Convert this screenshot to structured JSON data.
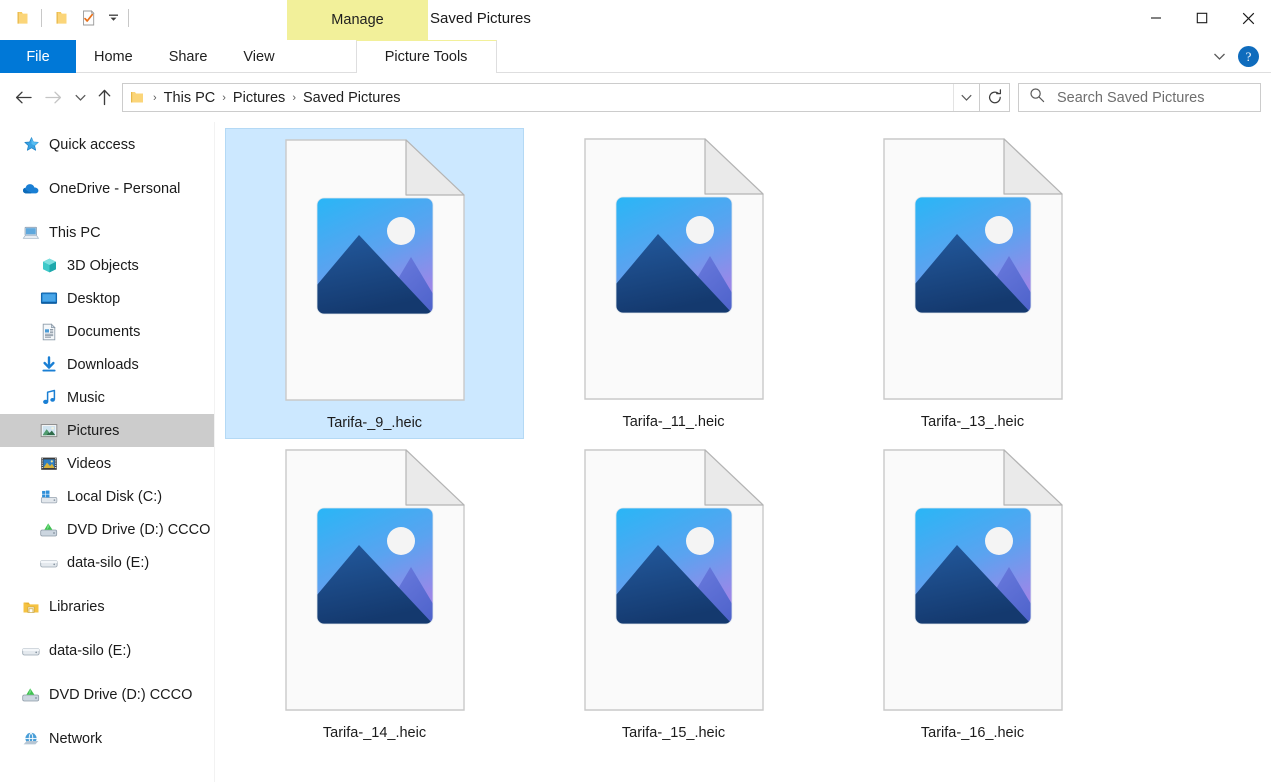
{
  "window": {
    "title": "Saved Pictures",
    "contextual_tab_header": "Manage",
    "controls": {
      "minimize": "minimize-button",
      "maximize": "maximize-button",
      "close": "close-button"
    }
  },
  "quick_access_toolbar": {
    "items": [
      {
        "name": "explorer-folder-icon",
        "icon": "folder"
      },
      {
        "name": "new-folder-icon",
        "icon": "folder"
      },
      {
        "name": "properties-icon",
        "icon": "properties"
      },
      {
        "name": "customize-dropdown",
        "icon": "chevron-down"
      }
    ]
  },
  "ribbon": {
    "tabs": [
      {
        "label": "File",
        "active": false,
        "style": "file"
      },
      {
        "label": "Home",
        "active": false,
        "style": "normal"
      },
      {
        "label": "Share",
        "active": false,
        "style": "normal"
      },
      {
        "label": "View",
        "active": false,
        "style": "normal"
      },
      {
        "label": "Picture Tools",
        "active": true,
        "style": "contextual"
      }
    ],
    "collapse_label": "collapse-ribbon",
    "help_label": "?"
  },
  "navigation": {
    "back": "back-button",
    "forward": "forward-button",
    "recent": "recent-locations-button",
    "up": "up-button",
    "refresh": "refresh-button",
    "breadcrumb": [
      "This PC",
      "Pictures",
      "Saved Pictures"
    ],
    "breadcrumb_separator": "›",
    "dropdown": "address-dropdown"
  },
  "search": {
    "placeholder": "Search Saved Pictures",
    "value": ""
  },
  "sidebar": {
    "items": [
      {
        "label": "Quick access",
        "icon": "star",
        "indent": false,
        "selected": false,
        "gap_before": false
      },
      {
        "label": "OneDrive - Personal",
        "icon": "cloud",
        "indent": false,
        "selected": false,
        "gap_before": true
      },
      {
        "label": "This PC",
        "icon": "pc",
        "indent": false,
        "selected": false,
        "gap_before": true
      },
      {
        "label": "3D Objects",
        "icon": "cube",
        "indent": true,
        "selected": false,
        "gap_before": false
      },
      {
        "label": "Desktop",
        "icon": "desktop",
        "indent": true,
        "selected": false,
        "gap_before": false
      },
      {
        "label": "Documents",
        "icon": "document",
        "indent": true,
        "selected": false,
        "gap_before": false
      },
      {
        "label": "Downloads",
        "icon": "download",
        "indent": true,
        "selected": false,
        "gap_before": false
      },
      {
        "label": "Music",
        "icon": "music",
        "indent": true,
        "selected": false,
        "gap_before": false
      },
      {
        "label": "Pictures",
        "icon": "picture",
        "indent": true,
        "selected": true,
        "gap_before": false
      },
      {
        "label": "Videos",
        "icon": "video",
        "indent": true,
        "selected": false,
        "gap_before": false
      },
      {
        "label": "Local Disk (C:)",
        "icon": "windows-disk",
        "indent": true,
        "selected": false,
        "gap_before": false
      },
      {
        "label": "DVD Drive (D:) CCCO",
        "icon": "dvd",
        "indent": true,
        "selected": false,
        "gap_before": false
      },
      {
        "label": "data-silo (E:)",
        "icon": "disk",
        "indent": true,
        "selected": false,
        "gap_before": false
      },
      {
        "label": "Libraries",
        "icon": "libraries",
        "indent": false,
        "selected": false,
        "gap_before": true
      },
      {
        "label": "data-silo (E:)",
        "icon": "disk",
        "indent": false,
        "selected": false,
        "gap_before": true
      },
      {
        "label": "DVD Drive (D:) CCCO",
        "icon": "dvd",
        "indent": false,
        "selected": false,
        "gap_before": true
      },
      {
        "label": "Network",
        "icon": "network",
        "indent": false,
        "selected": false,
        "gap_before": true
      }
    ]
  },
  "files": [
    {
      "name": "Tarifa-_9_.heic",
      "type": "heic-image",
      "selected": true
    },
    {
      "name": "Tarifa-_11_.heic",
      "type": "heic-image",
      "selected": false
    },
    {
      "name": "Tarifa-_13_.heic",
      "type": "heic-image",
      "selected": false
    },
    {
      "name": "Tarifa-_14_.heic",
      "type": "heic-image",
      "selected": false
    },
    {
      "name": "Tarifa-_15_.heic",
      "type": "heic-image",
      "selected": false
    },
    {
      "name": "Tarifa-_16_.heic",
      "type": "heic-image",
      "selected": false
    }
  ],
  "colors": {
    "accent": "#0078d7",
    "contextual_tab": "#f2f09a",
    "selection": "#cce8ff",
    "sidebar_selection": "#cccccc",
    "sky_top": "#29b6f6",
    "sky_bottom": "#8b7fe8",
    "mountain_front": "#1a4c8b",
    "mountain_back": "#6170d8"
  }
}
